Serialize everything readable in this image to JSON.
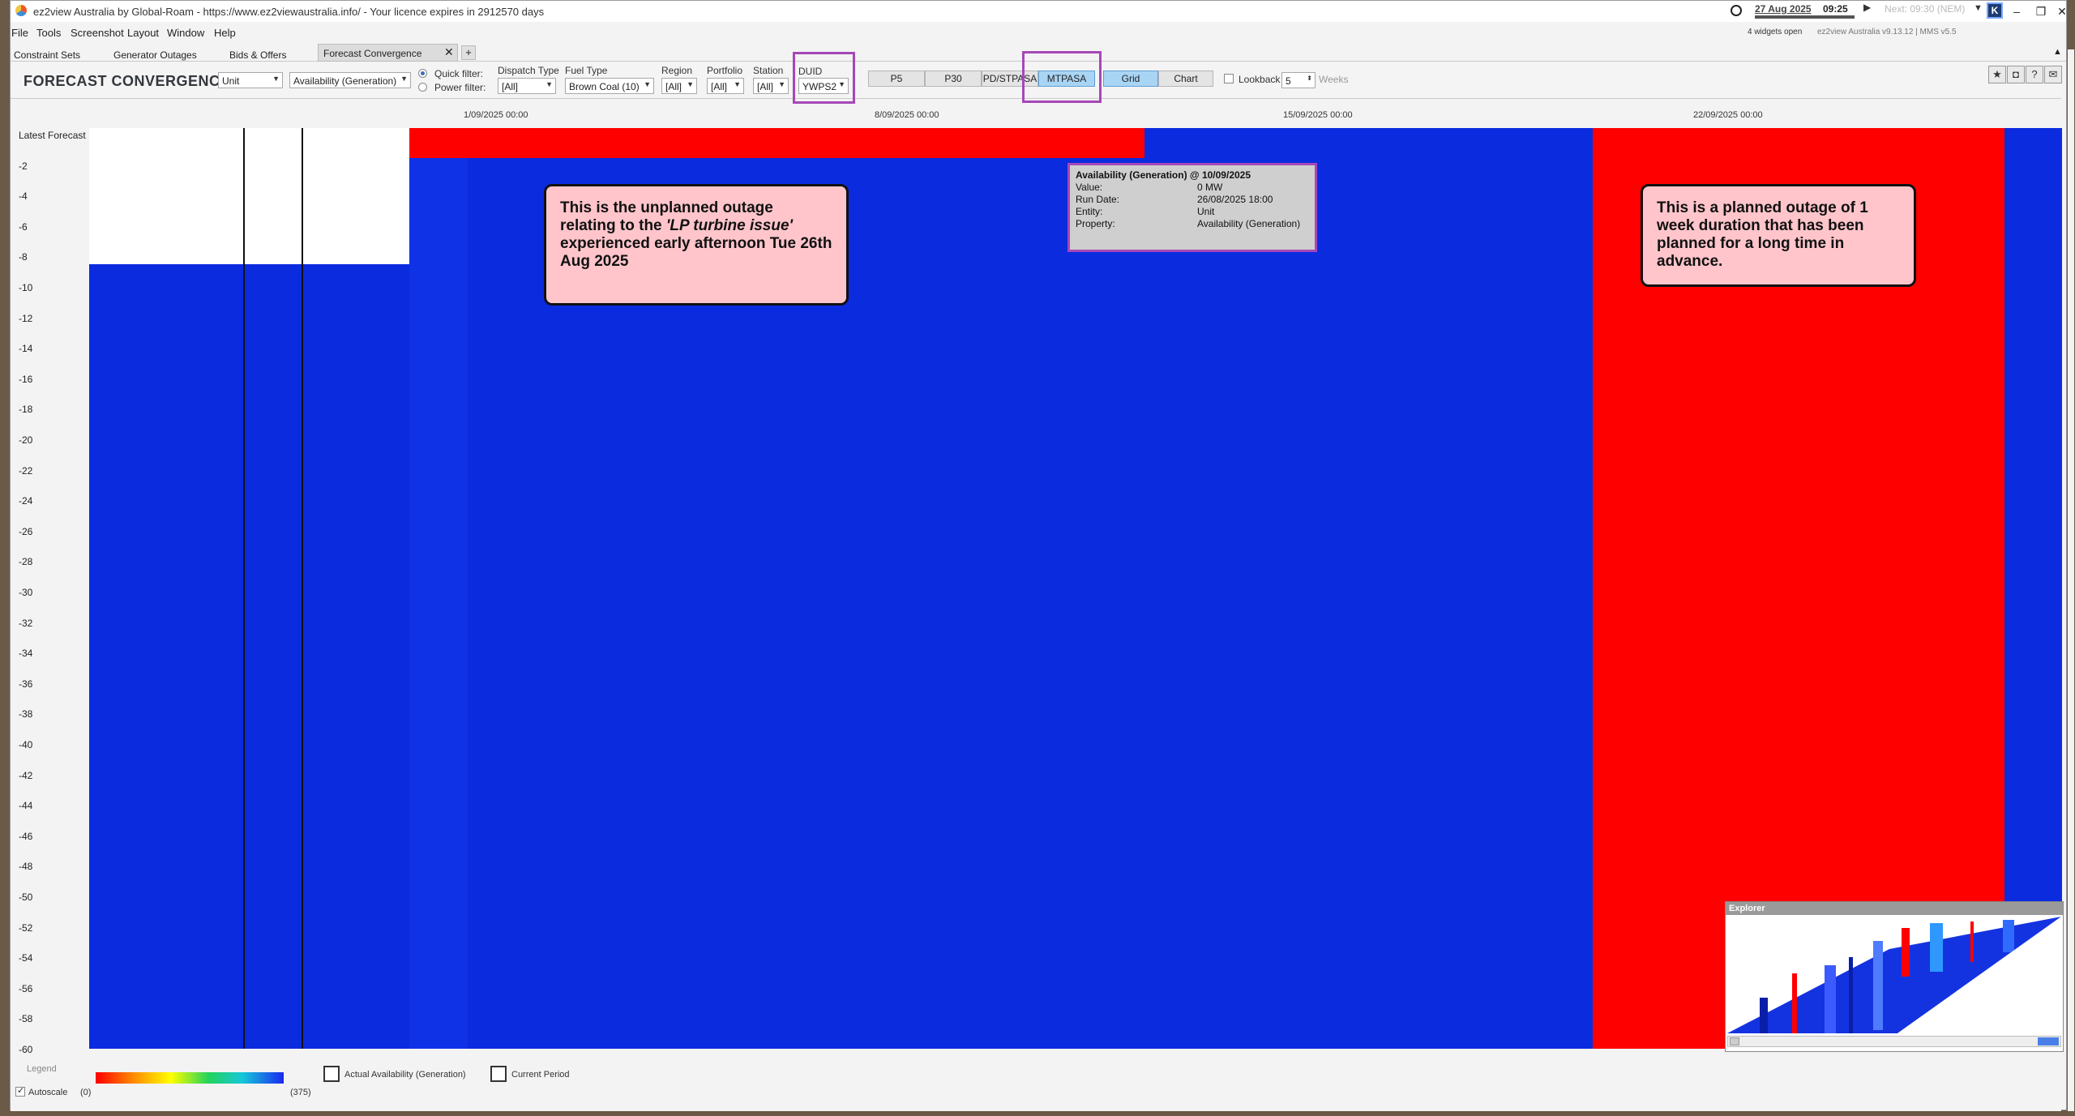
{
  "titlebar": {
    "title": "ez2view Australia by Global-Roam - https://www.ez2viewaustralia.info/ - Your licence expires in 2912570 days",
    "clock_date": "27 Aug 2025",
    "clock_time": "09:25",
    "next": "Next: 09:30 (NEM)",
    "widgets_open": "4 widgets open",
    "version": "ez2view Australia v9.13.12 | MMS v5.5",
    "logo": "K"
  },
  "menu": [
    "File",
    "Tools",
    "Screenshot",
    "Layout",
    "Window",
    "Help"
  ],
  "tabs": [
    {
      "label": "Constraint Sets"
    },
    {
      "label": "Generator Outages"
    },
    {
      "label": "Bids & Offers"
    },
    {
      "label": "Forecast Convergence",
      "active": true
    }
  ],
  "toolbar": {
    "widget_title": "FORECAST CONVERGENCE",
    "entity_type": "Unit",
    "property": "Availability (Generation)",
    "quick_filter": "Quick filter:",
    "power_filter": "Power filter:",
    "filters": [
      {
        "label": "Dispatch Type",
        "value": "[All]"
      },
      {
        "label": "Fuel Type",
        "value": "Brown Coal (10)"
      },
      {
        "label": "Region",
        "value": "[All]"
      },
      {
        "label": "Portfolio",
        "value": "[All]"
      },
      {
        "label": "Station",
        "value": "[All]"
      },
      {
        "label": "DUID",
        "value": "YWPS2"
      }
    ],
    "forecast_types": [
      "P5",
      "P30",
      "PD/STPASA",
      "MTPASA"
    ],
    "active_forecast": "MTPASA",
    "view_modes": [
      "Grid",
      "Chart"
    ],
    "active_view": "Grid",
    "lookback_label": "Lookback",
    "lookback_value": "5",
    "lookback_unit": "Weeks"
  },
  "axis": {
    "x_ticks": [
      "1/09/2025 00:00",
      "8/09/2025 00:00",
      "15/09/2025 00:00",
      "22/09/2025 00:00"
    ],
    "y_labels": [
      "Latest Forecast",
      "-2",
      "-4",
      "-6",
      "-8",
      "-10",
      "-12",
      "-14",
      "-16",
      "-18",
      "-20",
      "-22",
      "-24",
      "-26",
      "-28",
      "-30",
      "-32",
      "-34",
      "-36",
      "-38",
      "-40",
      "-42",
      "-44",
      "-46",
      "-48",
      "-50",
      "-52",
      "-54",
      "-56",
      "-58",
      "-60"
    ]
  },
  "annotations": {
    "unplanned_1": "This is the unplanned outage relating to the ",
    "unplanned_em": "'LP turbine issue'",
    "unplanned_2": " experienced early afternoon Tue 26th Aug 2025",
    "planned": "This is a planned outage of  1 week duration that has been planned for a long time in advance."
  },
  "tooltip": {
    "title": "Availability (Generation) @ 10/09/2025",
    "rows": [
      {
        "k": "Value:",
        "v": "0 MW"
      },
      {
        "k": "Run Date:",
        "v": "26/08/2025 18:00"
      },
      {
        "k": "Entity:",
        "v": "Unit"
      },
      {
        "k": "Property:",
        "v": "Availability (Generation)"
      }
    ]
  },
  "explorer": {
    "title": "Explorer"
  },
  "legend": {
    "label": "Legend",
    "autoscale": "Autoscale",
    "min": "(0)",
    "max": "(375)",
    "actual": "Actual Availability (Generation)",
    "current": "Current Period"
  },
  "colors": {
    "available": "#0b2bdf",
    "outage": "#ff0000",
    "accent_highlight": "#a548b7",
    "callout": "#ffc5cb"
  }
}
